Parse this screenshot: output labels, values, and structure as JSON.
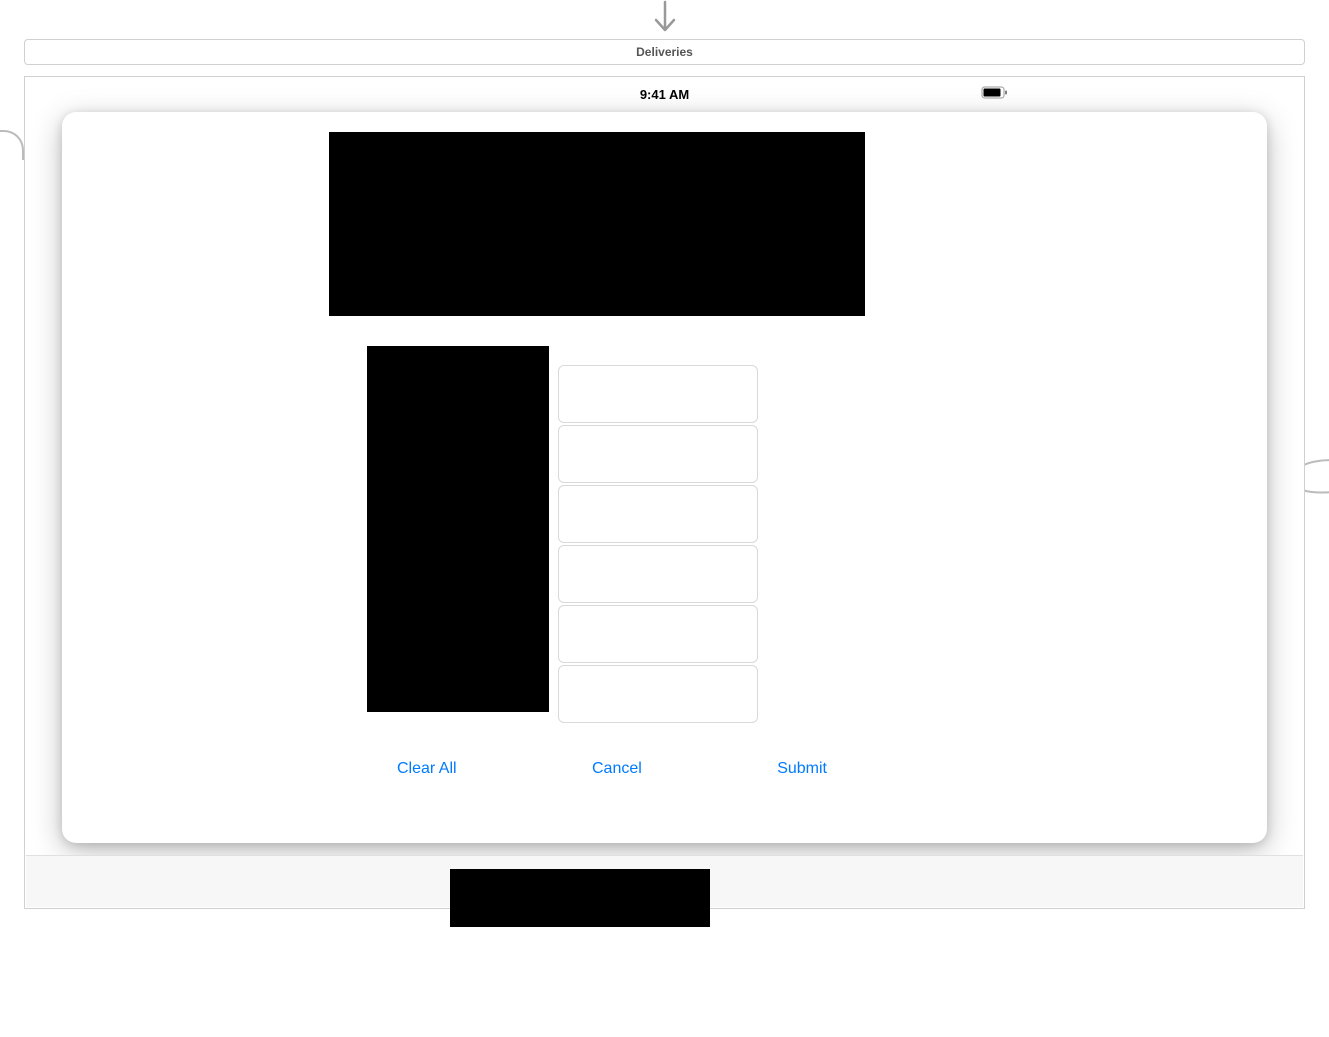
{
  "tab": {
    "label": "Deliveries"
  },
  "status_bar": {
    "time": "9:41 AM"
  },
  "form": {
    "fields": [
      {
        "value": ""
      },
      {
        "value": ""
      },
      {
        "value": ""
      },
      {
        "value": ""
      },
      {
        "value": ""
      },
      {
        "value": ""
      }
    ]
  },
  "buttons": {
    "clear_all": "Clear All",
    "cancel": "Cancel",
    "submit": "Submit"
  }
}
